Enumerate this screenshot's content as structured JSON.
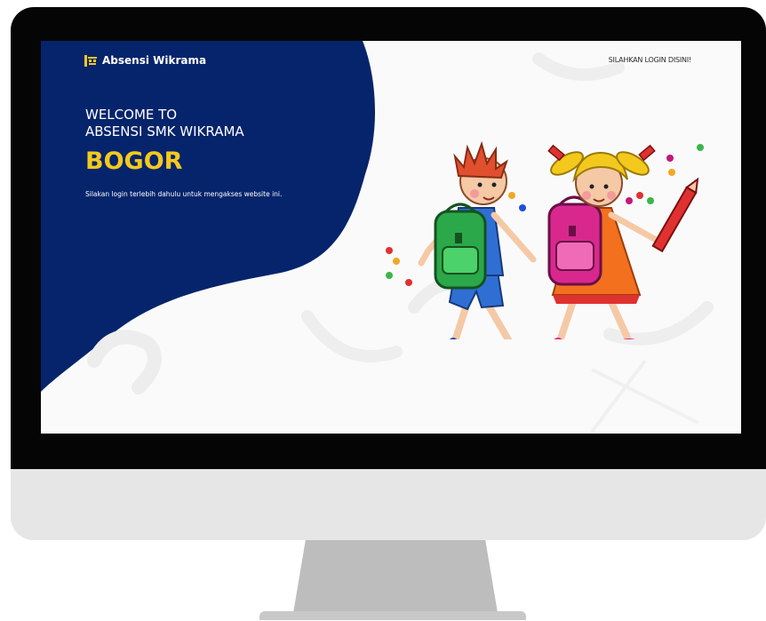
{
  "header": {
    "brand_name": "Absensi Wikrama",
    "login_link": "SILAHKAN LOGIN DISINI!"
  },
  "hero": {
    "welcome_line": "WELCOME TO",
    "school_line": "ABSENSI SMK WIKRAMA",
    "city": "BOGOR",
    "description": "Silakan login terlebih dahulu untuk mengakses website ini."
  },
  "colors": {
    "panel": "#06246b",
    "accent": "#f4c91e",
    "monitor_bezel": "#050505",
    "monitor_chin": "#e6e6e6"
  },
  "icons": {
    "brand_logo": "school-logo-icon",
    "illustration": "school-kids-illustration"
  }
}
